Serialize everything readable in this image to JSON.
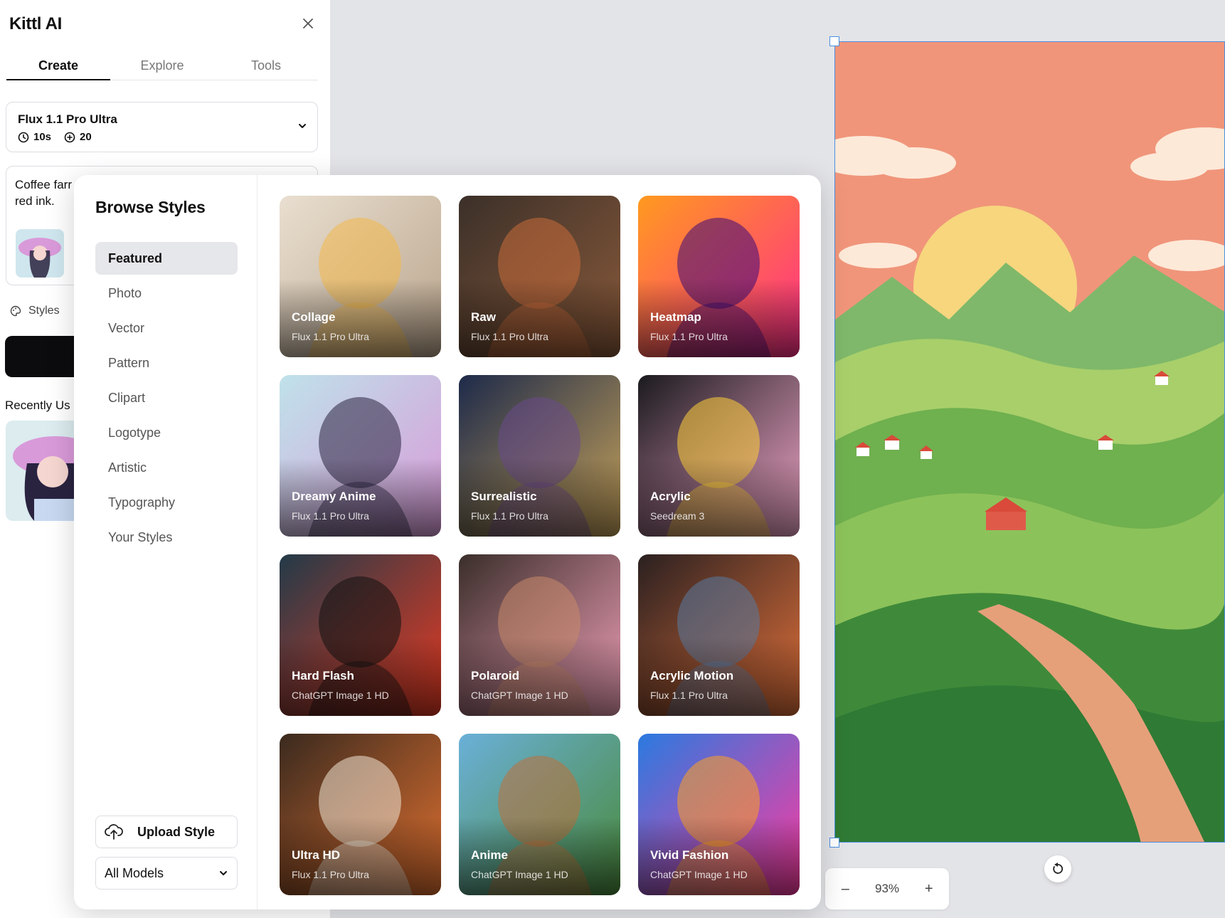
{
  "panel": {
    "title": "Kittl AI",
    "tabs": [
      {
        "label": "Create",
        "active": true
      },
      {
        "label": "Explore",
        "active": false
      },
      {
        "label": "Tools",
        "active": false
      }
    ],
    "model": {
      "name": "Flux 1.1 Pro Ultra",
      "time": "10s",
      "credits": "20"
    },
    "prompt_text": "Coffee farr\nred ink.",
    "styles_label": "Styles",
    "recent_label": "Recently Us"
  },
  "browse": {
    "title": "Browse Styles",
    "categories": [
      {
        "label": "Featured",
        "active": true
      },
      {
        "label": "Photo"
      },
      {
        "label": "Vector"
      },
      {
        "label": "Pattern"
      },
      {
        "label": "Clipart"
      },
      {
        "label": "Logotype"
      },
      {
        "label": "Artistic"
      },
      {
        "label": "Typography"
      },
      {
        "label": "Your Styles"
      }
    ],
    "upload_label": "Upload Style",
    "models_select": "All Models",
    "styles": [
      {
        "name": "Collage",
        "model": "Flux 1.1 Pro Ultra",
        "colors": [
          "#e9dfd0",
          "#b9a48b",
          "#f2b84b"
        ]
      },
      {
        "name": "Raw",
        "model": "Flux 1.1 Pro Ultra",
        "colors": [
          "#3b3029",
          "#8a5a3a",
          "#c96b3a"
        ]
      },
      {
        "name": "Heatmap",
        "model": "Flux 1.1 Pro Ultra",
        "colors": [
          "#ff9a1f",
          "#ff2d8a",
          "#3b0a78"
        ]
      },
      {
        "name": "Dreamy Anime",
        "model": "Flux 1.1 Pro Ultra",
        "colors": [
          "#bfe2ea",
          "#d89ad8",
          "#2a2340"
        ]
      },
      {
        "name": "Surrealistic",
        "model": "Flux 1.1 Pro Ultra",
        "colors": [
          "#1d2a4a",
          "#c6a25a",
          "#6a4a8a"
        ]
      },
      {
        "name": "Acrylic",
        "model": "Seedream 3",
        "colors": [
          "#1a1a1e",
          "#f1a6c8",
          "#ffcf3a"
        ]
      },
      {
        "name": "Hard Flash",
        "model": "ChatGPT Image 1 HD",
        "colors": [
          "#223a48",
          "#e83a22",
          "#111111"
        ]
      },
      {
        "name": "Polaroid",
        "model": "ChatGPT Image 1 HD",
        "colors": [
          "#3a2e2a",
          "#f0a0b8",
          "#c98a6a"
        ]
      },
      {
        "name": "Acrylic Motion",
        "model": "Flux 1.1 Pro Ultra",
        "colors": [
          "#2a2020",
          "#e0703a",
          "#5a7aa0"
        ]
      },
      {
        "name": "Ultra HD",
        "model": "Flux 1.1 Pro Ultra",
        "colors": [
          "#3a2a1e",
          "#e07030",
          "#f0e6d6"
        ]
      },
      {
        "name": "Anime",
        "model": "ChatGPT Image 1 HD",
        "colors": [
          "#6ab0d8",
          "#4a8a3a",
          "#c0703a"
        ]
      },
      {
        "name": "Vivid Fashion",
        "model": "ChatGPT Image 1 HD",
        "colors": [
          "#2a7ae0",
          "#ff3aa0",
          "#ffa020"
        ]
      }
    ]
  },
  "canvas": {
    "zoom": "93%",
    "zoom_out": "–",
    "zoom_in": "+"
  },
  "colors": {
    "accent": "#4a90e2",
    "artboard_sky": "#f0957a",
    "sun": "#f7d67e",
    "hill_light": "#a8cf6a",
    "hill_dark": "#3f8a3a"
  }
}
